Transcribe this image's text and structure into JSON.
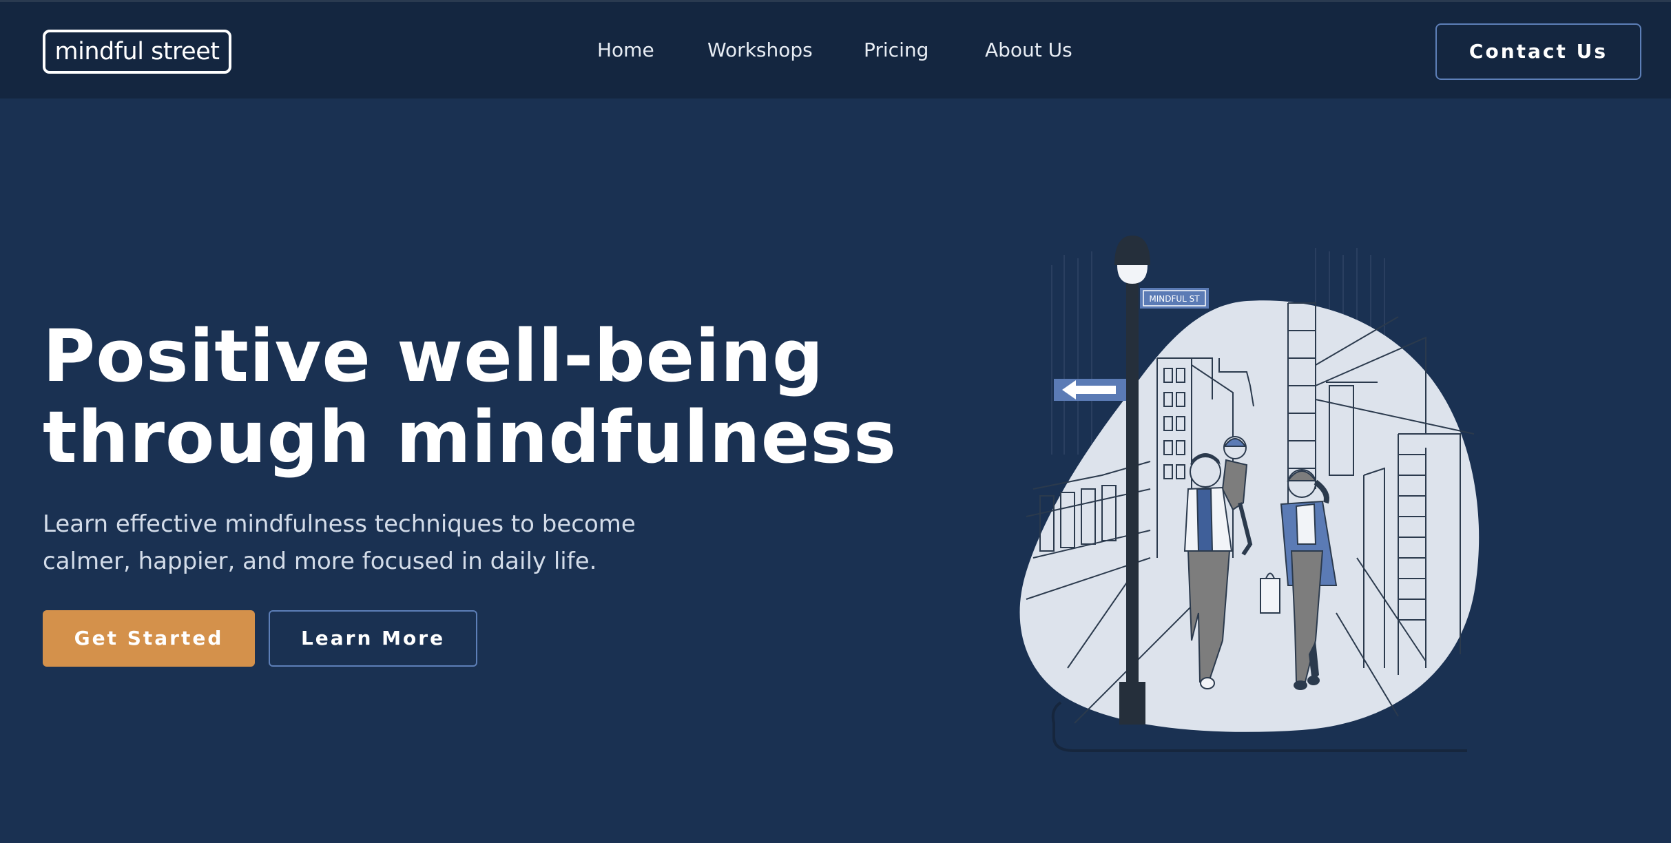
{
  "header": {
    "logo_text": "mindful street",
    "nav": [
      {
        "label": "Home"
      },
      {
        "label": "Workshops"
      },
      {
        "label": "Pricing"
      },
      {
        "label": "About Us"
      }
    ],
    "contact_label": "Contact Us"
  },
  "hero": {
    "title_lines": [
      "Positive well-being",
      "through mindfulness"
    ],
    "subtitle_lines": [
      "Learn effective mindfulness techniques to become",
      "calmer, happier, and more focused in daily life."
    ],
    "primary_button": "Get Started",
    "secondary_button": "Learn More"
  },
  "illustration": {
    "street_sign": "MINDFUL ST"
  },
  "colors": {
    "page_background": "#1a3152",
    "header_background": "#142640",
    "accent_orange": "#d4914b",
    "outline_blue": "#5d7fb8",
    "blob_fill": "#dde3ec"
  }
}
